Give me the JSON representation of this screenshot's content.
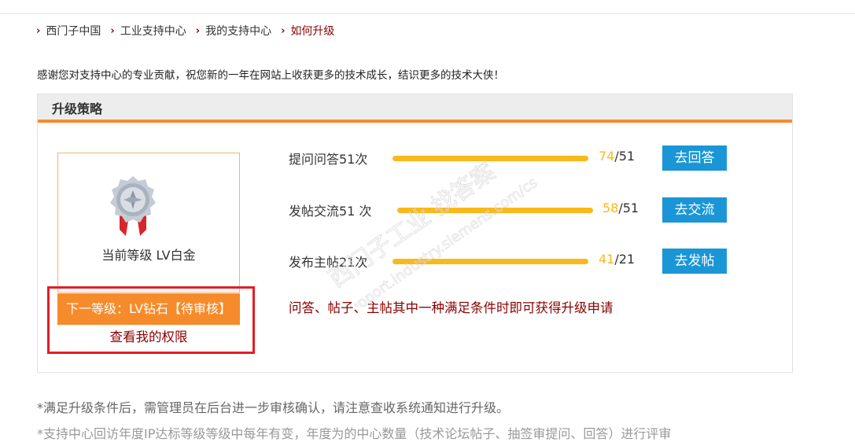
{
  "breadcrumb": {
    "items": [
      "西门子中国",
      "工业支持中心",
      "我的支持中心",
      "如何升级"
    ]
  },
  "intro_text": "感谢您对支持中心的专业贡献，祝您新的一年在网站上收获更多的技术成长，结识更多的技术大侠！",
  "panel": {
    "title": "升级策略",
    "current_level": "当前等级 LV白金",
    "next_level": "下一等级：LV钻石【待审核】",
    "view_rights": "查看我的权限"
  },
  "tasks": [
    {
      "label": "提问问答51次",
      "current": "74",
      "total": "/51",
      "button": "去回答"
    },
    {
      "label": "发帖交流51 次",
      "current": "58",
      "total": "/51",
      "button": "去交流"
    },
    {
      "label": "发布主帖21次",
      "current": "41",
      "total": "/21",
      "button": "去发帖"
    }
  ],
  "rule_text": "问答、帖子、主帖其中一种满足条件时即可获得升级申请",
  "footnote": "*满足升级条件后，需管理员在后台进一步审核确认，请注意查收系统通知进行升级。",
  "footnote2": "*支持中心回访年度IP达标等级等级中每年有变，年度为的中心数量（技术论坛帖子、抽签审提问、回答）进行评审",
  "watermark": {
    "text": "西门子工业 找答案",
    "url": "support.industry.siemens.com/cs"
  },
  "colors": {
    "accent_orange": "#f68b2b",
    "dark_red": "#8b0000",
    "blue_button": "#1a96d6",
    "progress_yellow": "#f8b91c",
    "highlight_red": "#e31e24"
  }
}
